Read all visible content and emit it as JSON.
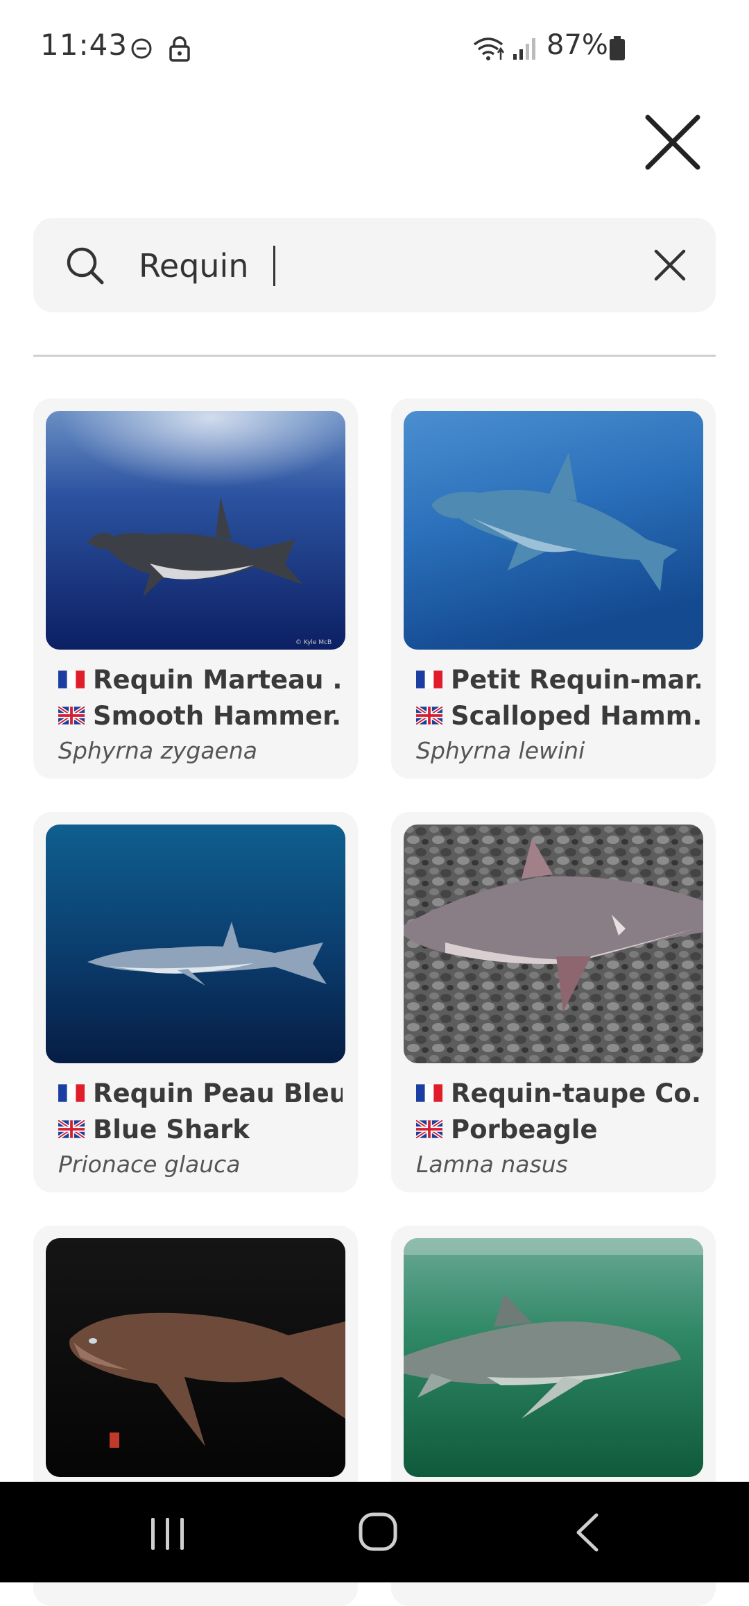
{
  "status_bar": {
    "time": "11:43",
    "battery": "87%",
    "icons": [
      "do-not-disturb-icon",
      "lock-icon",
      "wifi-icon",
      "signal-icon",
      "battery-icon"
    ]
  },
  "header": {
    "close_icon": "close-icon"
  },
  "search": {
    "value": "Requin",
    "placeholder": "",
    "clear_icon": "clear-icon"
  },
  "results": [
    {
      "fr": "Requin Marteau ...",
      "en": "Smooth Hammer...",
      "scientific": "Sphyrna zygaena",
      "credit": "© Kyle McB"
    },
    {
      "fr": "Petit Requin-mar...",
      "en": "Scalloped Hamm...",
      "scientific": "Sphyrna lewini"
    },
    {
      "fr": "Requin Peau Bleue",
      "en": "Blue Shark",
      "scientific": "Prionace glauca"
    },
    {
      "fr": "Requin-taupe Co...",
      "en": "Porbeagle",
      "scientific": "Lamna nasus"
    },
    {
      "fr": "",
      "en": "",
      "scientific": ""
    },
    {
      "fr": "",
      "en": "",
      "scientific": ""
    }
  ],
  "colors": {
    "card_bg": "#f5f5f5",
    "search_bg": "#f4f4f4",
    "nav_bg": "#000000"
  }
}
